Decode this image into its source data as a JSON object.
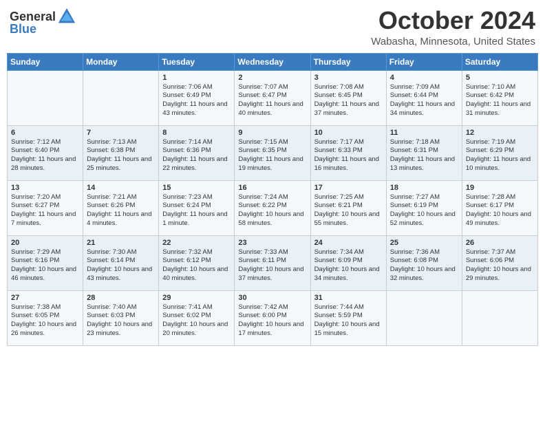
{
  "header": {
    "logo_general": "General",
    "logo_blue": "Blue",
    "month": "October 2024",
    "location": "Wabasha, Minnesota, United States"
  },
  "days_of_week": [
    "Sunday",
    "Monday",
    "Tuesday",
    "Wednesday",
    "Thursday",
    "Friday",
    "Saturday"
  ],
  "weeks": [
    [
      {
        "day": "",
        "content": ""
      },
      {
        "day": "",
        "content": ""
      },
      {
        "day": "1",
        "content": "Sunrise: 7:06 AM\nSunset: 6:49 PM\nDaylight: 11 hours and 43 minutes."
      },
      {
        "day": "2",
        "content": "Sunrise: 7:07 AM\nSunset: 6:47 PM\nDaylight: 11 hours and 40 minutes."
      },
      {
        "day": "3",
        "content": "Sunrise: 7:08 AM\nSunset: 6:45 PM\nDaylight: 11 hours and 37 minutes."
      },
      {
        "day": "4",
        "content": "Sunrise: 7:09 AM\nSunset: 6:44 PM\nDaylight: 11 hours and 34 minutes."
      },
      {
        "day": "5",
        "content": "Sunrise: 7:10 AM\nSunset: 6:42 PM\nDaylight: 11 hours and 31 minutes."
      }
    ],
    [
      {
        "day": "6",
        "content": "Sunrise: 7:12 AM\nSunset: 6:40 PM\nDaylight: 11 hours and 28 minutes."
      },
      {
        "day": "7",
        "content": "Sunrise: 7:13 AM\nSunset: 6:38 PM\nDaylight: 11 hours and 25 minutes."
      },
      {
        "day": "8",
        "content": "Sunrise: 7:14 AM\nSunset: 6:36 PM\nDaylight: 11 hours and 22 minutes."
      },
      {
        "day": "9",
        "content": "Sunrise: 7:15 AM\nSunset: 6:35 PM\nDaylight: 11 hours and 19 minutes."
      },
      {
        "day": "10",
        "content": "Sunrise: 7:17 AM\nSunset: 6:33 PM\nDaylight: 11 hours and 16 minutes."
      },
      {
        "day": "11",
        "content": "Sunrise: 7:18 AM\nSunset: 6:31 PM\nDaylight: 11 hours and 13 minutes."
      },
      {
        "day": "12",
        "content": "Sunrise: 7:19 AM\nSunset: 6:29 PM\nDaylight: 11 hours and 10 minutes."
      }
    ],
    [
      {
        "day": "13",
        "content": "Sunrise: 7:20 AM\nSunset: 6:27 PM\nDaylight: 11 hours and 7 minutes."
      },
      {
        "day": "14",
        "content": "Sunrise: 7:21 AM\nSunset: 6:26 PM\nDaylight: 11 hours and 4 minutes."
      },
      {
        "day": "15",
        "content": "Sunrise: 7:23 AM\nSunset: 6:24 PM\nDaylight: 11 hours and 1 minute."
      },
      {
        "day": "16",
        "content": "Sunrise: 7:24 AM\nSunset: 6:22 PM\nDaylight: 10 hours and 58 minutes."
      },
      {
        "day": "17",
        "content": "Sunrise: 7:25 AM\nSunset: 6:21 PM\nDaylight: 10 hours and 55 minutes."
      },
      {
        "day": "18",
        "content": "Sunrise: 7:27 AM\nSunset: 6:19 PM\nDaylight: 10 hours and 52 minutes."
      },
      {
        "day": "19",
        "content": "Sunrise: 7:28 AM\nSunset: 6:17 PM\nDaylight: 10 hours and 49 minutes."
      }
    ],
    [
      {
        "day": "20",
        "content": "Sunrise: 7:29 AM\nSunset: 6:16 PM\nDaylight: 10 hours and 46 minutes."
      },
      {
        "day": "21",
        "content": "Sunrise: 7:30 AM\nSunset: 6:14 PM\nDaylight: 10 hours and 43 minutes."
      },
      {
        "day": "22",
        "content": "Sunrise: 7:32 AM\nSunset: 6:12 PM\nDaylight: 10 hours and 40 minutes."
      },
      {
        "day": "23",
        "content": "Sunrise: 7:33 AM\nSunset: 6:11 PM\nDaylight: 10 hours and 37 minutes."
      },
      {
        "day": "24",
        "content": "Sunrise: 7:34 AM\nSunset: 6:09 PM\nDaylight: 10 hours and 34 minutes."
      },
      {
        "day": "25",
        "content": "Sunrise: 7:36 AM\nSunset: 6:08 PM\nDaylight: 10 hours and 32 minutes."
      },
      {
        "day": "26",
        "content": "Sunrise: 7:37 AM\nSunset: 6:06 PM\nDaylight: 10 hours and 29 minutes."
      }
    ],
    [
      {
        "day": "27",
        "content": "Sunrise: 7:38 AM\nSunset: 6:05 PM\nDaylight: 10 hours and 26 minutes."
      },
      {
        "day": "28",
        "content": "Sunrise: 7:40 AM\nSunset: 6:03 PM\nDaylight: 10 hours and 23 minutes."
      },
      {
        "day": "29",
        "content": "Sunrise: 7:41 AM\nSunset: 6:02 PM\nDaylight: 10 hours and 20 minutes."
      },
      {
        "day": "30",
        "content": "Sunrise: 7:42 AM\nSunset: 6:00 PM\nDaylight: 10 hours and 17 minutes."
      },
      {
        "day": "31",
        "content": "Sunrise: 7:44 AM\nSunset: 5:59 PM\nDaylight: 10 hours and 15 minutes."
      },
      {
        "day": "",
        "content": ""
      },
      {
        "day": "",
        "content": ""
      }
    ]
  ]
}
